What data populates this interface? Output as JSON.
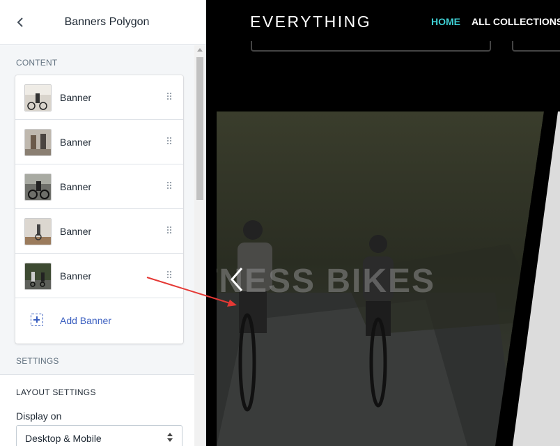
{
  "editor": {
    "title": "Banners Polygon",
    "content_label": "CONTENT",
    "blocks": [
      {
        "label": "Banner"
      },
      {
        "label": "Banner"
      },
      {
        "label": "Banner"
      },
      {
        "label": "Banner"
      },
      {
        "label": "Banner"
      }
    ],
    "add_label": "Add Banner",
    "settings_label": "SETTINGS",
    "layout_heading": "LAYOUT SETTINGS",
    "display_label": "Display on",
    "display_value": "Desktop & Mobile",
    "link_color": "#3b5fc0"
  },
  "preview": {
    "logo": "EVERYTHING",
    "nav": {
      "home": "HOME",
      "all_collections": "ALL COLLECTIONS"
    },
    "nav_active_color": "#3fd0d4",
    "hero_text": "TNESS BIKES"
  },
  "icons": {
    "back": "chevron-left-icon",
    "drag": "drag-handle-icon",
    "add": "add-block-icon",
    "slider_prev": "chevron-left-icon"
  }
}
